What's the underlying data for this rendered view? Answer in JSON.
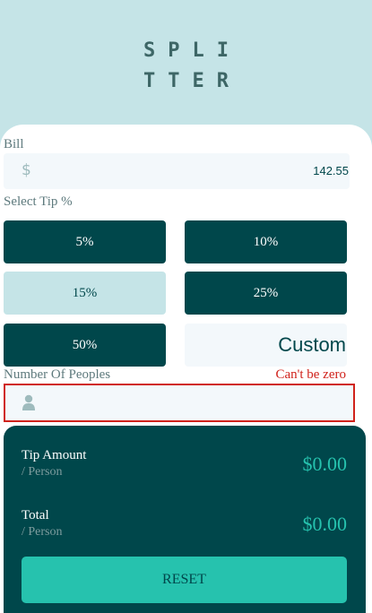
{
  "logo": {
    "line1": "SPLI",
    "line2": "TTER"
  },
  "bill": {
    "label": "Bill",
    "currency_symbol": "$",
    "value": "142.55"
  },
  "tip": {
    "label": "Select Tip %",
    "options": [
      "5%",
      "10%",
      "15%",
      "25%",
      "50%"
    ],
    "selected": "15%",
    "custom_label": "Custom"
  },
  "people": {
    "label": "Number Of Peoples",
    "error": "Can't be zero",
    "value": "",
    "icon": "person-icon"
  },
  "results": {
    "tip_amount_label": "Tip Amount",
    "per_person_label": "/ Person",
    "tip_amount_value": "$0.00",
    "total_label": "Total",
    "total_per_person_label": "/ Person",
    "total_value": "$0.00",
    "reset_label": "RESET"
  },
  "colors": {
    "background": "#c5e4e7",
    "dark_cyan": "#00474b",
    "strong_cyan": "#26c2ae",
    "error": "#d0221b"
  }
}
